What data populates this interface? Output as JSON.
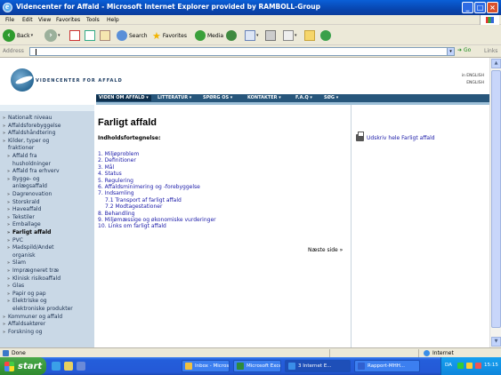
{
  "window": {
    "title": "Videncenter for Affald - Microsoft Internet Explorer provided by RAMBOLL-Group"
  },
  "menu": [
    "File",
    "Edit",
    "View",
    "Favorites",
    "Tools",
    "Help"
  ],
  "toolbar": {
    "back": "Back",
    "search": "Search",
    "favorites": "Favorites",
    "media": "Media"
  },
  "address": {
    "label": "Address",
    "value": "",
    "go": "Go",
    "links": "Links"
  },
  "site": {
    "name": "VIDENCENTER FOR AFFALD",
    "lang": [
      "in ENGLISH",
      "ENGLISH"
    ]
  },
  "nav": [
    "VIDEN OM AFFALD ▾",
    "LITTERATUR ▾",
    "SPØRG OS ▾",
    "KONTAKTER ▾",
    "F.A.Q ▾",
    "SØG ▾"
  ],
  "sidebar": [
    {
      "label": "Nationalt niveau",
      "marker": "»",
      "bold": false
    },
    {
      "label": "Affaldsforebyggelse",
      "marker": "»",
      "bold": false
    },
    {
      "label": "Affaldshåndtering",
      "marker": "»",
      "bold": false
    },
    {
      "label": "Kilder, typer og",
      "marker": "»",
      "bold": false
    },
    {
      "label": "fraktioner",
      "marker": "",
      "bold": false
    },
    {
      "label": "Affald fra",
      "marker": "»",
      "bold": false,
      "indent": true
    },
    {
      "label": "husholdninger",
      "marker": "",
      "bold": false,
      "indent": true
    },
    {
      "label": "Affald fra erhverv",
      "marker": "»",
      "bold": false,
      "indent": true
    },
    {
      "label": "Bygge- og",
      "marker": "»",
      "bold": false,
      "indent": true
    },
    {
      "label": "anlægsaffald",
      "marker": "",
      "bold": false,
      "indent": true
    },
    {
      "label": "Dagrenovation",
      "marker": "»",
      "bold": false,
      "indent": true
    },
    {
      "label": "Storskrald",
      "marker": "»",
      "bold": false,
      "indent": true
    },
    {
      "label": "Haveaffald",
      "marker": "»",
      "bold": false,
      "indent": true
    },
    {
      "label": "Tekstiler",
      "marker": "»",
      "bold": false,
      "indent": true
    },
    {
      "label": "Emballage",
      "marker": "»",
      "bold": false,
      "indent": true
    },
    {
      "label": "Farligt affald",
      "marker": "»",
      "bold": true,
      "indent": true
    },
    {
      "label": "PVC",
      "marker": "»",
      "bold": false,
      "indent": true
    },
    {
      "label": "Madspild/Andet",
      "marker": "»",
      "bold": false,
      "indent": true
    },
    {
      "label": "organisk",
      "marker": "",
      "bold": false,
      "indent": true
    },
    {
      "label": "Slam",
      "marker": "»",
      "bold": false,
      "indent": true
    },
    {
      "label": "Imprægneret træ",
      "marker": "»",
      "bold": false,
      "indent": true
    },
    {
      "label": "Klinisk risikoaffald",
      "marker": "»",
      "bold": false,
      "indent": true
    },
    {
      "label": "Glas",
      "marker": "»",
      "bold": false,
      "indent": true
    },
    {
      "label": "Papir og pap",
      "marker": "»",
      "bold": false,
      "indent": true
    },
    {
      "label": "Elektriske og",
      "marker": "»",
      "bold": false,
      "indent": true
    },
    {
      "label": "elektroniske produkter",
      "marker": "",
      "bold": false,
      "indent": true
    },
    {
      "label": "Kommuner og affald",
      "marker": "»",
      "bold": false
    },
    {
      "label": "Affaldsaktører",
      "marker": "»",
      "bold": false
    },
    {
      "label": "Forskning og",
      "marker": "»",
      "bold": false
    }
  ],
  "main": {
    "title": "Farligt affald",
    "toc_heading": "Indholdsfortegnelse:",
    "toc": [
      {
        "text": "1. Miljøproblem",
        "sub": false
      },
      {
        "text": "2. Definitioner",
        "sub": false
      },
      {
        "text": "3. Mål",
        "sub": false
      },
      {
        "text": "4. Status",
        "sub": false
      },
      {
        "text": "5. Regulering",
        "sub": false
      },
      {
        "text": "6. Affaldsminimering og -forebyggelse",
        "sub": false
      },
      {
        "text": "7. Indsamling",
        "sub": false
      },
      {
        "text": "7.1 Transport af farligt affald",
        "sub": true
      },
      {
        "text": "7.2 Modtagestationer",
        "sub": true
      },
      {
        "text": "8. Behandling",
        "sub": false
      },
      {
        "text": "9. Miljømæssige og økonomiske vurderinger",
        "sub": false
      },
      {
        "text": "10. Links om farligt affald",
        "sub": false
      }
    ],
    "next": "Næste side »",
    "print": "Udskriv hele Farligt affald"
  },
  "status": {
    "left": "Done",
    "zone": "Internet"
  },
  "taskbar": {
    "start": "start",
    "tasks": [
      {
        "label": "Inbox - Micros...",
        "color": "#f0c040"
      },
      {
        "label": "Microsoft Excel",
        "color": "#2e8b3a"
      },
      {
        "label": "3 Internet E...",
        "color": "#3a8ee8"
      },
      {
        "label": "Rapport-MHH...",
        "color": "#3060d0"
      }
    ],
    "lang": "DA",
    "clock": "15:15"
  }
}
